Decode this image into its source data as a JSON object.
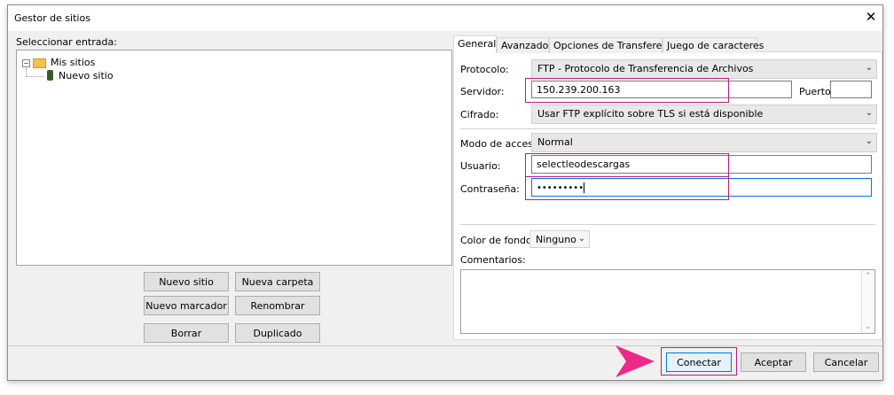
{
  "window": {
    "title": "Gestor de sitios"
  },
  "left": {
    "select_label": "Seleccionar entrada:",
    "tree": {
      "root": "Mis sitios",
      "child": "Nuevo sitio"
    },
    "buttons": {
      "new_site": "Nuevo sitio",
      "new_folder": "Nueva carpeta",
      "new_bookmark": "Nuevo marcador",
      "rename": "Renombrar",
      "delete": "Borrar",
      "duplicate": "Duplicado"
    }
  },
  "tabs": [
    "General",
    "Avanzado",
    "Opciones de Transferencia",
    "Juego de caracteres"
  ],
  "general": {
    "protocol_label": "Protocolo:",
    "protocol_value": "FTP - Protocolo de Transferencia de Archivos",
    "server_label": "Servidor:",
    "server_value": "150.239.200.163",
    "port_label": "Puerto:",
    "port_value": "",
    "encryption_label": "Cifrado:",
    "encryption_value": "Usar FTP explícito sobre TLS si está disponible",
    "access_label": "Modo de acceso:",
    "access_value": "Normal",
    "user_label": "Usuario:",
    "user_value": "selectleodescargas",
    "password_label": "Contraseña:",
    "password_value": "•••••••••",
    "bgcolor_label": "Color de fondo:",
    "bgcolor_value": "Ninguno",
    "comments_label": "Comentarios:",
    "comments_value": ""
  },
  "footer": {
    "connect": "Conectar",
    "accept": "Aceptar",
    "cancel": "Cancelar"
  },
  "colors": {
    "highlight": "#c2187f",
    "arrow": "#ec2a8a",
    "focus": "#0078d7"
  }
}
